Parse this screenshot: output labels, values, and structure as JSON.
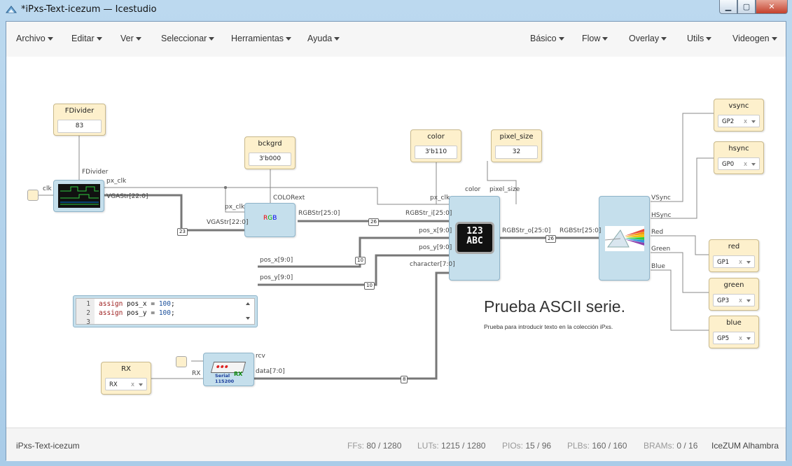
{
  "window": {
    "title": "*iPxs-Text-icezum — Icestudio",
    "min_glyph": "▁",
    "max_glyph": "▢",
    "close_glyph": "✕"
  },
  "menu": {
    "left": [
      "Archivo",
      "Editar",
      "Ver",
      "Seleccionar",
      "Herramientas",
      "Ayuda"
    ],
    "right": [
      "Básico",
      "Flow",
      "Overlay",
      "Utils",
      "Videogen"
    ]
  },
  "blocks": {
    "fdivider": {
      "label": "FDivider",
      "value": "83"
    },
    "bckgrd": {
      "label": "bckgrd",
      "value": "3'b000"
    },
    "color": {
      "label": "color",
      "value": "3'b110"
    },
    "pixel_size": {
      "label": "pixel_size",
      "value": "32"
    },
    "vsync": {
      "label": "vsync",
      "pin": "GP2"
    },
    "hsync": {
      "label": "hsync",
      "pin": "GP0"
    },
    "red": {
      "label": "red",
      "pin": "GP1"
    },
    "green": {
      "label": "green",
      "pin": "GP3"
    },
    "blue": {
      "label": "blue",
      "pin": "GP5"
    },
    "rx": {
      "label": "RX",
      "pin": "RX"
    }
  },
  "ports": {
    "clk": "clk",
    "fdivider": "FDivider",
    "px_clk": "px_clk",
    "vgastr": "VGAStr[22:0]",
    "rgb_px_clk": "px_clk",
    "rgb_vgastr": "VGAStr[22:0]",
    "colorext": "COLORext",
    "rgbstr_out": "RGBStr[25:0]",
    "txt_color": "color",
    "txt_pixel_size": "pixel_size",
    "txt_px_clk": "px_clk",
    "txt_rgbstr_i": "RGBStr_i[25:0]",
    "txt_pos_x": "pos_x[9:0]",
    "txt_pos_y": "pos_y[9:0]",
    "txt_character": "character[7:0]",
    "txt_rgbstr_o": "RGBStr_o[25:0]",
    "code_pos_x": "pos_x[9:0]",
    "code_pos_y": "pos_y[9:0]",
    "out_rgbstr": "RGBStr[25:0]",
    "vsync": "VSync",
    "hsync": "HSync",
    "red": "Red",
    "green": "Green",
    "blue": "Blue",
    "serial_rx": "RX",
    "serial_rcv": "rcv",
    "serial_data": "data[7:0]"
  },
  "bus_widths": {
    "vga": "23",
    "rgb1": "26",
    "rgb2": "26",
    "posx": "10",
    "posy": "10",
    "data": "8"
  },
  "code": {
    "lines": [
      {
        "n": "1",
        "kw": "assign",
        "mid": " pos_x = ",
        "num": "100",
        "end": ";"
      },
      {
        "n": "2",
        "kw": "assign",
        "mid": " pos_y = ",
        "num": "100",
        "end": ";"
      },
      {
        "n": "3",
        "kw": "",
        "mid": "",
        "num": "",
        "end": ""
      }
    ]
  },
  "text_module": {
    "line1": "123",
    "line2": "ABC"
  },
  "serial_module": {
    "line1": "Serial",
    "line2": "115200",
    "tag": "RX"
  },
  "rgb_module": {
    "r": "R",
    "g": "G",
    "b": "B"
  },
  "info": {
    "title": "Prueba ASCII serie.",
    "subtitle": "Prueba para introducir texto en la colección iPxs."
  },
  "status": {
    "project": "iPxs-Text-icezum",
    "ffs_label": "FFs:",
    "ffs": "80 / 1280",
    "luts_label": "LUTs:",
    "luts": "1215 / 1280",
    "pios_label": "PIOs:",
    "pios": "15 / 96",
    "plbs_label": "PLBs:",
    "plbs": "160 / 160",
    "brams_label": "BRAMs:",
    "brams": "0 / 16",
    "board": "IceZUM Alhambra"
  }
}
